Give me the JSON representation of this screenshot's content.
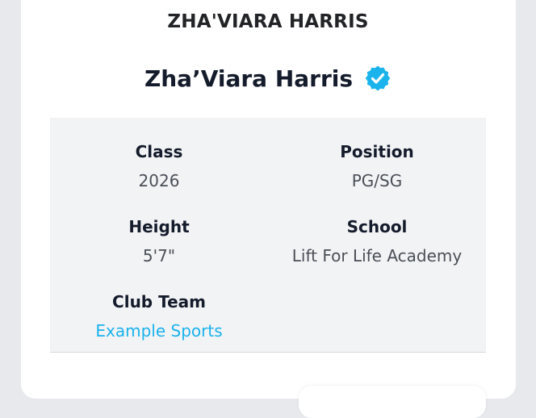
{
  "header": {
    "banner_name": "ZHA'VIARA HARRIS"
  },
  "profile": {
    "name": "Zha’Viara Harris",
    "verified_icon": "verified-badge-icon",
    "verified_color": "#1ab3ec"
  },
  "details": {
    "class_label": "Class",
    "class_value": "2026",
    "position_label": "Position",
    "position_value": "PG/SG",
    "height_label": "Height",
    "height_value": "5'7\"",
    "school_label": "School",
    "school_value": "Lift For Life Academy",
    "club_team_label": "Club Team",
    "club_team_value": "Example Sports"
  },
  "colors": {
    "background": "#e8e9ed",
    "card": "#ffffff",
    "panel": "#f2f3f5",
    "link": "#1ab3ec",
    "heading": "#141b2b"
  }
}
